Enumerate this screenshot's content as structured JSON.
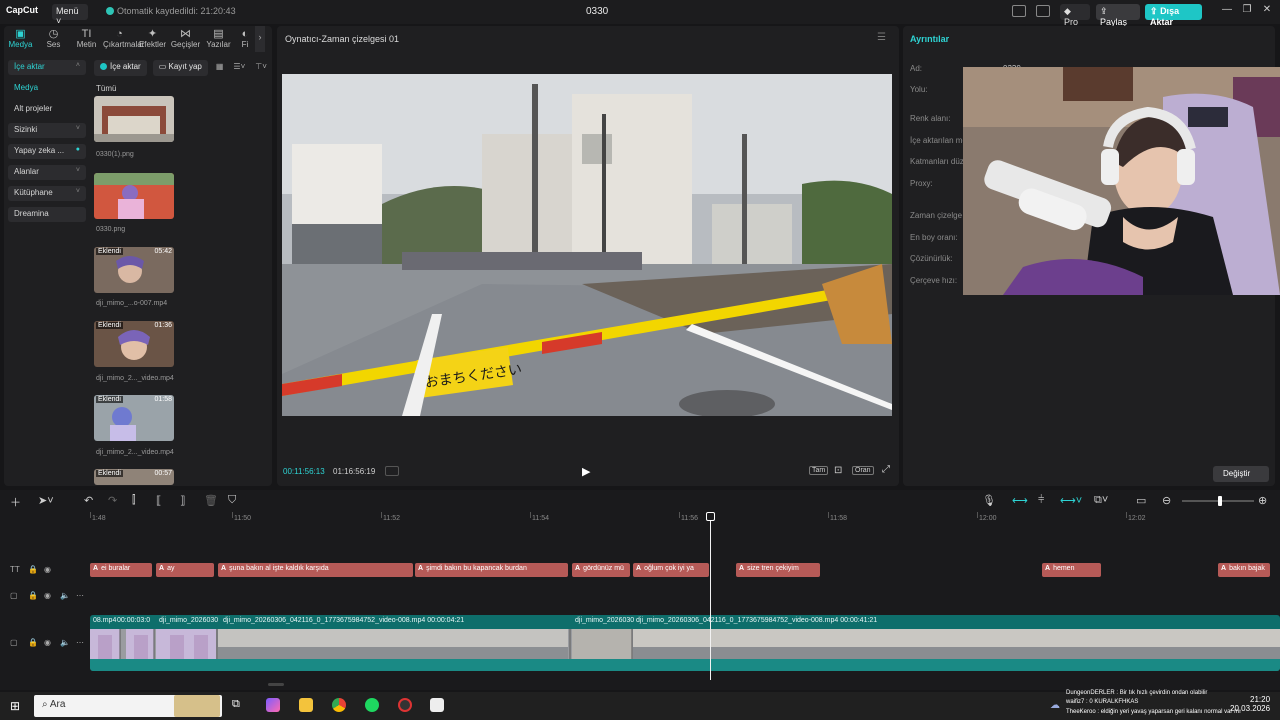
{
  "titlebar": {
    "app_name": "CapCut",
    "menu_label": "Menü",
    "autosave_text": "Otomatik kaydedildi: 21:20:43",
    "project_name": "0330",
    "pro_label": "Pro",
    "share_label": "Paylaş",
    "export_label": "Dışa Aktar"
  },
  "tool_tabs": [
    {
      "label": "Medya",
      "icon": "media-icon"
    },
    {
      "label": "Ses",
      "icon": "audio-icon"
    },
    {
      "label": "Metin",
      "icon": "text-icon"
    },
    {
      "label": "Çıkartmalar",
      "icon": "sticker-icon"
    },
    {
      "label": "Efektler",
      "icon": "effects-icon"
    },
    {
      "label": "Geçişler",
      "icon": "transitions-icon"
    },
    {
      "label": "Yazılar",
      "icon": "captions-icon"
    },
    {
      "label": "Fi",
      "icon": "filters-icon"
    }
  ],
  "categories": [
    {
      "label": "İçe aktar",
      "chev": "˄"
    },
    {
      "label": "Medya",
      "chev": ""
    },
    {
      "label": "Alt projeler",
      "chev": ""
    },
    {
      "label": "Sizinki",
      "chev": "˅"
    },
    {
      "label": "Yapay zeka ...",
      "chev": "˅"
    },
    {
      "label": "Alanlar",
      "chev": "˅"
    },
    {
      "label": "Kütüphane",
      "chev": "˅"
    },
    {
      "label": "Dreamina",
      "chev": ""
    }
  ],
  "media_toolbar": {
    "import_label": "İçe aktar",
    "record_label": "Kayıt yap"
  },
  "media_section_label": "Tümü",
  "media_items": [
    {
      "name": "0330(1).png",
      "added": "",
      "duration": ""
    },
    {
      "name": "0330.png",
      "added": "",
      "duration": ""
    },
    {
      "name": "dji_mimo_...o-007.mp4",
      "added": "Eklendi",
      "duration": "05:42"
    },
    {
      "name": "dji_mimo_2..._video.mp4",
      "added": "Eklendi",
      "duration": "01:36"
    },
    {
      "name": "dji_mimo_2..._video.mp4",
      "added": "Eklendi",
      "duration": "01:58"
    },
    {
      "name": "",
      "added": "Eklendi",
      "duration": "00:57"
    }
  ],
  "player": {
    "title": "Oynatıcı-Zaman çizelgesi 01",
    "current_time": "00:11:56:13",
    "total_time": "01:16:56:19",
    "full_label": "Tam",
    "ratio_label": "Oran",
    "sign_text": "おまちください"
  },
  "details": {
    "title": "Ayrıntılar",
    "labels": [
      "Ad:",
      "Yolu:",
      "Renk alanı:",
      "İçe aktarılan me",
      "Katmanları düz",
      "Proxy:",
      "Zaman çizelge",
      "En boy oranı:",
      "Çözünürlük:",
      "Çerçeve hızı:"
    ],
    "name_value": "0330",
    "change_label": "Değiştir"
  },
  "timeline": {
    "ticks": [
      "1:48",
      "11:50",
      "11:52",
      "11:54",
      "11:56",
      "11:58",
      "12:00",
      "12:02"
    ],
    "captions": [
      {
        "text": "ei buralar"
      },
      {
        "text": "ay"
      },
      {
        "text": "şuna bakın al işte kaldık karşıda"
      },
      {
        "text": "şimdi bakın bu kapancak burdan"
      },
      {
        "text": "gördünüz mü"
      },
      {
        "text": "oğlum çok iyi ya"
      },
      {
        "text": "size tren çekiyim"
      },
      {
        "text": "hemen"
      },
      {
        "text": "bakın bajak"
      }
    ],
    "caption_tag": "A",
    "video_headers": [
      {
        "text": "08.mp4"
      },
      {
        "text": "00:00:03:0"
      },
      {
        "text": "dji_mimo_2026030"
      },
      {
        "text": "dji_mimo_20260306_042116_0_1773675984752_video-008.mp4   00:00:04:21"
      },
      {
        "text": "dji_mimo_2026030"
      },
      {
        "text": "dji_mimo_20260306_042116_0_1773675984752_video-008.mp4   00:00:41:21"
      }
    ]
  },
  "taskbar": {
    "search_placeholder": "Ara",
    "chat_lines": [
      "DungeonDERLER : Bir tık hızlı çevirdin ondan olabilir",
      "waifiz7 : 0 KURALKFHKAS",
      "TheeKeroo : eldiğin yeri yavaş yaparsan geri kalanı normal var mı"
    ],
    "time": "21:20",
    "date": "20.03.2026"
  }
}
